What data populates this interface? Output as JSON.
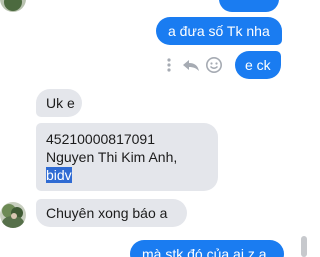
{
  "messages": {
    "out_1": "a đưa số Tk nha",
    "out_2": "e ck",
    "in_1": "Uk e",
    "in_2_line1": "45210000817091",
    "in_2_line2": "Nguyen Thi Kim Anh,",
    "in_2_line3_selected": "bidv",
    "in_3": "Chuyên xong báo a",
    "out_3": "mà stk đó của ai z a"
  },
  "actions": {
    "more_icon": "more-options-icon",
    "reply_icon": "reply-icon",
    "react_icon": "emoji-reaction-icon"
  },
  "colors": {
    "outgoing_bubble": "#1a7cf1",
    "incoming_bubble": "#e4e6eb",
    "selection_highlight": "#2f6bd3"
  }
}
